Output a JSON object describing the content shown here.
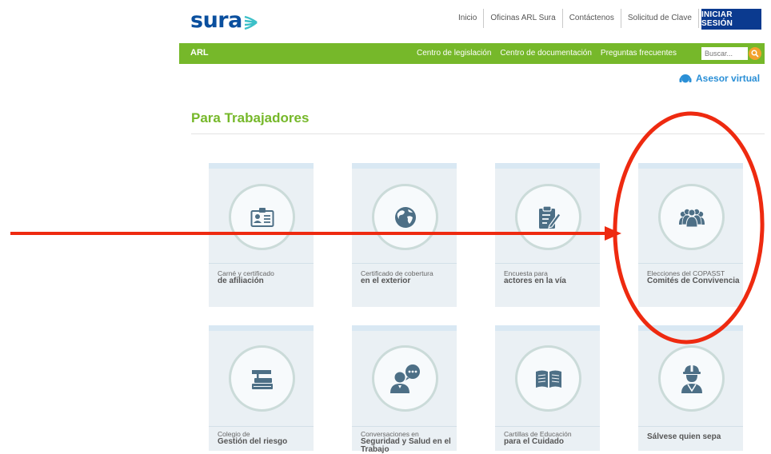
{
  "header": {
    "logo_text": "sura",
    "nav": [
      "Inicio",
      "Oficinas ARL Sura",
      "Contáctenos",
      "Solicitud de Clave"
    ],
    "login_label": "INICIAR SESIÓN"
  },
  "greenbar": {
    "brand": "ARL",
    "links": [
      "Centro de legislación",
      "Centro de documentación",
      "Preguntas frecuentes"
    ],
    "search_placeholder": "Buscar..."
  },
  "asesor_label": "Asesor virtual",
  "section_title": "Para Trabajadores",
  "cards": [
    {
      "sub": "Carné y certificado",
      "main": "de afiliación",
      "icon": "id-card-icon"
    },
    {
      "sub": "Certificado de cobertura",
      "main": "en el exterior",
      "icon": "globe-icon"
    },
    {
      "sub": "Encuesta para",
      "main": "actores en la vía",
      "icon": "clipboard-edit-icon"
    },
    {
      "sub": "Elecciones del COPASST",
      "main": "Comités de Convivencia",
      "icon": "group-icon"
    },
    {
      "sub": "Colegio de",
      "main": "Gestión del riesgo",
      "icon": "books-icon"
    },
    {
      "sub": "Conversaciones en",
      "main": "Seguridad y Salud en el Trabajo",
      "icon": "person-chat-icon"
    },
    {
      "sub": "Cartillas de Educación",
      "main": "para el Cuidado",
      "icon": "open-book-icon"
    },
    {
      "sub": "",
      "main": "Sálvese quien sepa",
      "icon": "worker-helmet-icon"
    }
  ],
  "colors": {
    "brand_green": "#76b82a",
    "brand_blue": "#0b3a8f",
    "accent_blue": "#2a8fd6",
    "annotation_red": "#ee2a10"
  }
}
